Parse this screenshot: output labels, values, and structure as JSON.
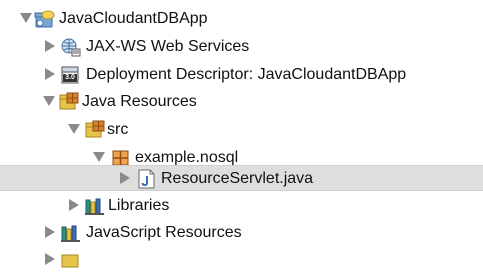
{
  "tree": {
    "project": {
      "label": "JavaCloudantDBApp",
      "icon": "project-icon",
      "expanded": true
    },
    "jaxws": {
      "label": "JAX-WS Web Services",
      "icon": "web-services-icon",
      "expanded": false
    },
    "deployment": {
      "label": "Deployment Descriptor: JavaCloudantDBApp",
      "icon": "deployment-descriptor-icon",
      "badge": "3.0",
      "expanded": false
    },
    "java_resources": {
      "label": "Java Resources",
      "icon": "java-resources-icon",
      "expanded": true
    },
    "src": {
      "label": "src",
      "icon": "source-folder-icon",
      "expanded": true
    },
    "package": {
      "label": "example.nosql",
      "icon": "package-icon",
      "expanded": true
    },
    "servlet": {
      "label": "ResourceServlet.java",
      "icon": "java-file-icon",
      "selected": true,
      "expanded": false
    },
    "libraries": {
      "label": "Libraries",
      "icon": "libraries-icon",
      "expanded": false
    },
    "javascript": {
      "label": "JavaScript Resources",
      "icon": "javascript-resources-icon",
      "expanded": false
    }
  },
  "colors": {
    "selection": "#dedede",
    "twisty": "#8a8a8a",
    "package_orange": "#d9822b",
    "folder_yellow": "#e8c44a",
    "library_teal": "#2a8f86"
  }
}
